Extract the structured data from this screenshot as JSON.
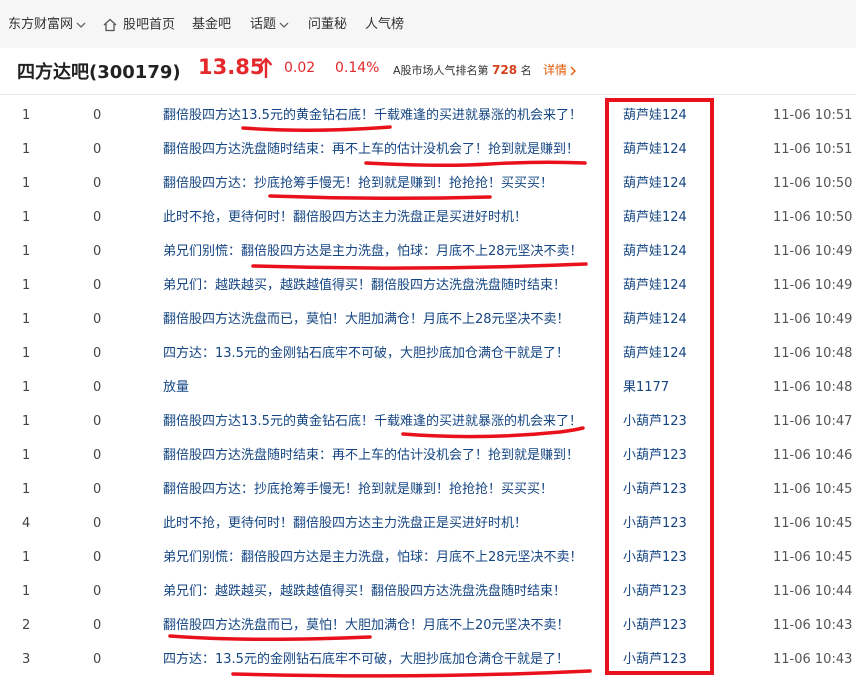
{
  "nav": {
    "site": "东方财富网",
    "home": "股吧首页",
    "fund": "基金吧",
    "topics": "话题",
    "ask": "问董秘",
    "popular": "人气榜"
  },
  "stock": {
    "name": "四方达吧(300179)",
    "price": "13.85",
    "change": "0.02",
    "pct": "0.14%",
    "rank_prefix": "A股市场人气排名第",
    "rank_value": "728",
    "rank_suffix": "名",
    "details": "详情"
  },
  "colors": {
    "up": "#e4282b",
    "link": "#154683",
    "annotation": "#e8111c"
  },
  "posts": [
    {
      "reads": "1",
      "replies": "0",
      "title": "翻倍股四方达13.5元的黄金钻石底！千载难逢的买进就暴涨的机会来了！",
      "author": "葫芦娃124",
      "time": "11-06 10:51"
    },
    {
      "reads": "1",
      "replies": "0",
      "title": "翻倍股四方达洗盘随时结束：再不上车的估计没机会了！抢到就是赚到！",
      "author": "葫芦娃124",
      "time": "11-06 10:51"
    },
    {
      "reads": "1",
      "replies": "0",
      "title": "翻倍股四方达：抄底抢筹手慢无！抢到就是赚到！抢抢抢！买买买！",
      "author": "葫芦娃124",
      "time": "11-06 10:50"
    },
    {
      "reads": "1",
      "replies": "0",
      "title": "此时不抢，更待何时！翻倍股四方达主力洗盘正是买进好时机！",
      "author": "葫芦娃124",
      "time": "11-06 10:50"
    },
    {
      "reads": "1",
      "replies": "0",
      "title": "弟兄们别慌：翻倍股四方达是主力洗盘，怕球：月底不上28元坚决不卖！",
      "author": "葫芦娃124",
      "time": "11-06 10:49"
    },
    {
      "reads": "1",
      "replies": "0",
      "title": "弟兄们：越跌越买，越跌越值得买！翻倍股四方达洗盘洗盘随时结束！",
      "author": "葫芦娃124",
      "time": "11-06 10:49"
    },
    {
      "reads": "1",
      "replies": "0",
      "title": "翻倍股四方达洗盘而已，莫怕！大胆加满仓！月底不上28元坚决不卖！",
      "author": "葫芦娃124",
      "time": "11-06 10:49"
    },
    {
      "reads": "1",
      "replies": "0",
      "title": "四方达：13.5元的金刚钻石底牢不可破，大胆抄底加仓满仓干就是了！",
      "author": "葫芦娃124",
      "time": "11-06 10:48"
    },
    {
      "reads": "1",
      "replies": "0",
      "title": "放量",
      "author": "果1177",
      "time": "11-06 10:48"
    },
    {
      "reads": "1",
      "replies": "0",
      "title": "翻倍股四方达13.5元的黄金钻石底！千载难逢的买进就暴涨的机会来了！",
      "author": "小葫芦123",
      "time": "11-06 10:47"
    },
    {
      "reads": "1",
      "replies": "0",
      "title": "翻倍股四方达洗盘随时结束：再不上车的估计没机会了！抢到就是赚到！",
      "author": "小葫芦123",
      "time": "11-06 10:46"
    },
    {
      "reads": "1",
      "replies": "0",
      "title": "翻倍股四方达：抄底抢筹手慢无！抢到就是赚到！抢抢抢！买买买！",
      "author": "小葫芦123",
      "time": "11-06 10:45"
    },
    {
      "reads": "4",
      "replies": "0",
      "title": "此时不抢，更待何时！翻倍股四方达主力洗盘正是买进好时机！",
      "author": "小葫芦123",
      "time": "11-06 10:45"
    },
    {
      "reads": "1",
      "replies": "0",
      "title": "弟兄们别慌：翻倍股四方达是主力洗盘，怕球：月底不上28元坚决不卖！",
      "author": "小葫芦123",
      "time": "11-06 10:45"
    },
    {
      "reads": "1",
      "replies": "0",
      "title": "弟兄们：越跌越买，越跌越值得买！翻倍股四方达洗盘洗盘随时结束！",
      "author": "小葫芦123",
      "time": "11-06 10:44"
    },
    {
      "reads": "2",
      "replies": "0",
      "title": "翻倍股四方达洗盘而已，莫怕！大胆加满仓！月底不上20元坚决不卖！",
      "author": "小葫芦123",
      "time": "11-06 10:43"
    },
    {
      "reads": "3",
      "replies": "0",
      "title": "四方达：13.5元的金刚钻石底牢不可破，大胆抄底加仓满仓干就是了！",
      "author": "小葫芦123",
      "time": "11-06 10:43"
    }
  ]
}
